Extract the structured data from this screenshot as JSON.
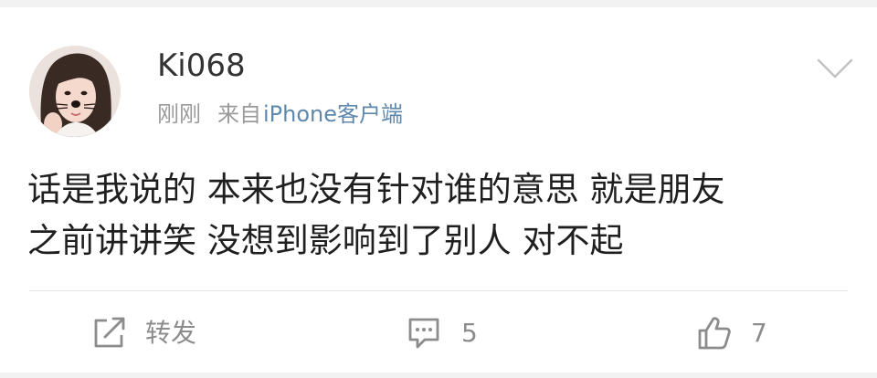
{
  "post": {
    "author": {
      "name": "Ki068"
    },
    "time": "刚刚",
    "source_prefix": "来自",
    "source": "iPhone客户端",
    "text": "话是我说的 本来也没有针对谁的意思 就是朋友\n之前讲讲笑 没想到影响到了别人 对不起"
  },
  "actions": {
    "repost": {
      "label": "转发",
      "icon": "share-box-icon"
    },
    "comment": {
      "count": "5",
      "icon": "comment-bubble-icon"
    },
    "like": {
      "count": "7",
      "icon": "thumbs-up-icon"
    }
  },
  "icons": {
    "menu": "chevron-down-icon"
  },
  "colors": {
    "text": "#1f1f1f",
    "meta": "#9a9a9a",
    "source_link": "#5f88ad",
    "action": "#8c8c8c",
    "divider": "#e6e6e6",
    "background": "#ffffff"
  }
}
